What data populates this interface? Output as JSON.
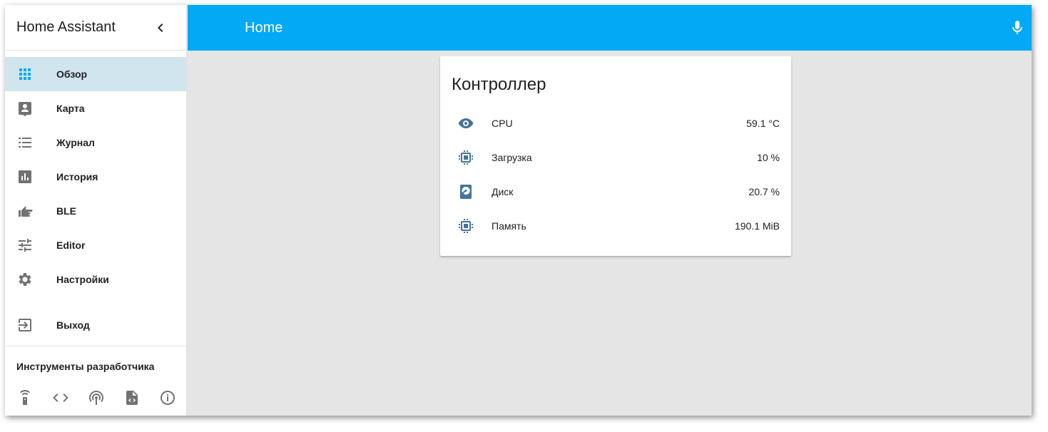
{
  "sidebar": {
    "app_title": "Home Assistant",
    "items": [
      {
        "label": "Обзор",
        "icon": "grid-icon",
        "active": true
      },
      {
        "label": "Карта",
        "icon": "account-box-icon"
      },
      {
        "label": "Журнал",
        "icon": "list-icon"
      },
      {
        "label": "История",
        "icon": "chart-bar-icon"
      },
      {
        "label": "BLE",
        "icon": "hand-pointing-icon"
      },
      {
        "label": "Editor",
        "icon": "tune-icon"
      },
      {
        "label": "Настройки",
        "icon": "gear-icon"
      }
    ],
    "logout": {
      "label": "Выход",
      "icon": "exit-icon"
    },
    "dev_tools_title": "Инструменты разработчика",
    "dev_tools": [
      "remote-icon",
      "code-icon",
      "broadcast-icon",
      "file-code-icon",
      "info-icon"
    ]
  },
  "topbar": {
    "title": "Home",
    "color": "#03a9f4"
  },
  "card": {
    "title": "Контроллер",
    "rows": [
      {
        "name": "CPU",
        "value": "59.1 °C",
        "icon": "eye-icon"
      },
      {
        "name": "Загрузка",
        "value": "10 %",
        "icon": "chip-icon"
      },
      {
        "name": "Диск",
        "value": "20.7 %",
        "icon": "harddisk-icon"
      },
      {
        "name": "Память",
        "value": "190.1 MiB",
        "icon": "chip-icon"
      }
    ]
  },
  "colors": {
    "accent": "#03a9f4",
    "active_item_bg": "#d1e5ef",
    "state_icon": "#44739e",
    "nav_icon": "#727272"
  }
}
